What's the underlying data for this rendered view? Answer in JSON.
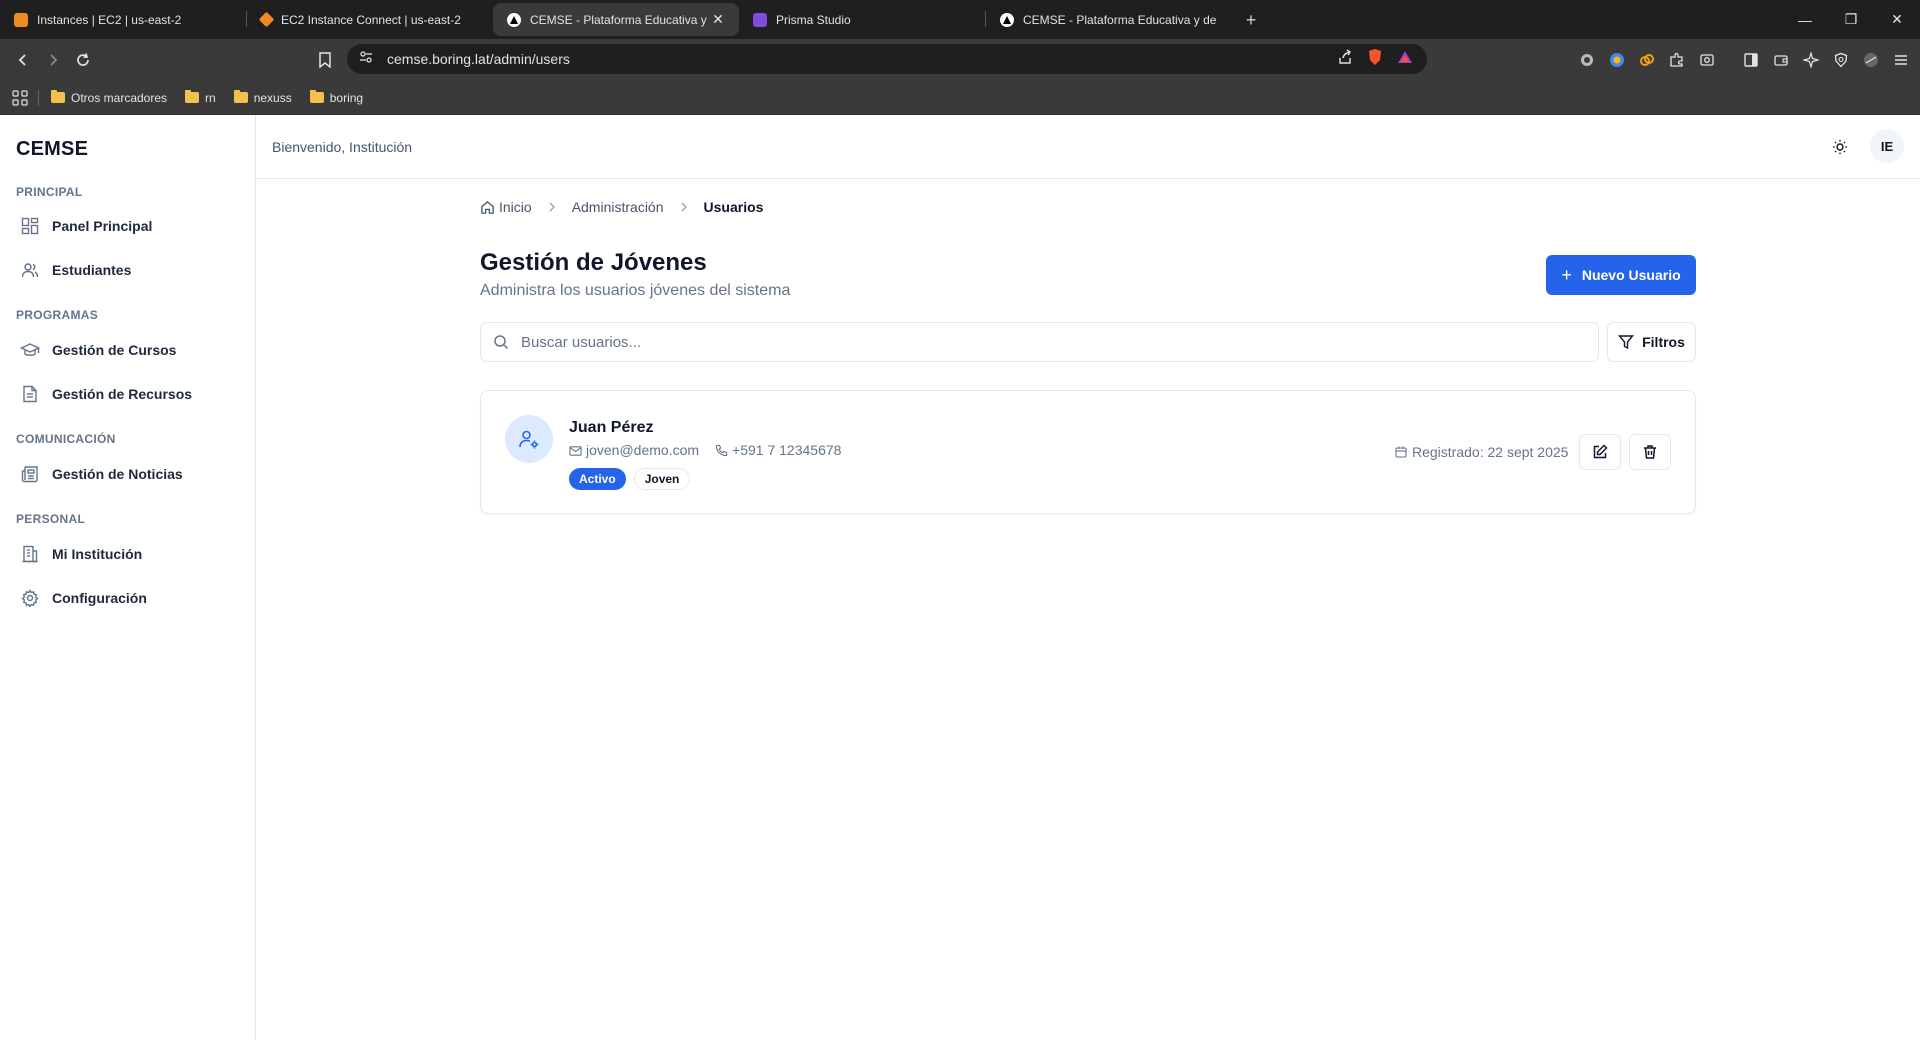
{
  "browser": {
    "tabs": [
      {
        "title": "Instances | EC2 | us-east-2",
        "favicon_color": "#f08a24"
      },
      {
        "title": "EC2 Instance Connect | us-east-2",
        "favicon_color": "#f08a24"
      },
      {
        "title": "CEMSE - Plataforma Educativa y",
        "favicon_color": "#000000",
        "active": true
      },
      {
        "title": "Prisma Studio",
        "favicon_color": "#7c4ddb"
      },
      {
        "title": "CEMSE - Plataforma Educativa y de E",
        "favicon_color": "#000000"
      }
    ],
    "url": "cemse.boring.lat/admin/users",
    "bookmarks": [
      "Otros marcadores",
      "rn",
      "nexuss",
      "boring"
    ]
  },
  "sidebar": {
    "brand": "CEMSE",
    "sections": [
      {
        "label": "PRINCIPAL",
        "items": [
          {
            "label": "Panel Principal",
            "icon": "dashboard-icon"
          },
          {
            "label": "Estudiantes",
            "icon": "users-icon"
          }
        ]
      },
      {
        "label": "PROGRAMAS",
        "items": [
          {
            "label": "Gestión de Cursos",
            "icon": "graduation-cap-icon"
          },
          {
            "label": "Gestión de Recursos",
            "icon": "document-icon"
          }
        ]
      },
      {
        "label": "COMUNICACIÓN",
        "items": [
          {
            "label": "Gestión de Noticias",
            "icon": "newspaper-icon"
          }
        ]
      },
      {
        "label": "PERSONAL",
        "items": [
          {
            "label": "Mi Institución",
            "icon": "building-icon"
          },
          {
            "label": "Configuración",
            "icon": "gear-icon"
          }
        ]
      }
    ]
  },
  "header": {
    "welcome": "Bienvenido, Institución",
    "avatar_initials": "IE"
  },
  "breadcrumb": [
    "Inicio",
    "Administración",
    "Usuarios"
  ],
  "page": {
    "title": "Gestión de Jóvenes",
    "subtitle": "Administra los usuarios jóvenes del sistema",
    "new_button": "Nuevo Usuario",
    "search_placeholder": "Buscar usuarios...",
    "filter_button": "Filtros"
  },
  "users": [
    {
      "name": "Juan Pérez",
      "email": "joven@demo.com",
      "phone": "+591 7 12345678",
      "status": "Activo",
      "role": "Joven",
      "registered": "Registrado: 22 sept 2025"
    }
  ],
  "colors": {
    "primary": "#2563eb",
    "avatar_bg": "#dbeafe"
  }
}
